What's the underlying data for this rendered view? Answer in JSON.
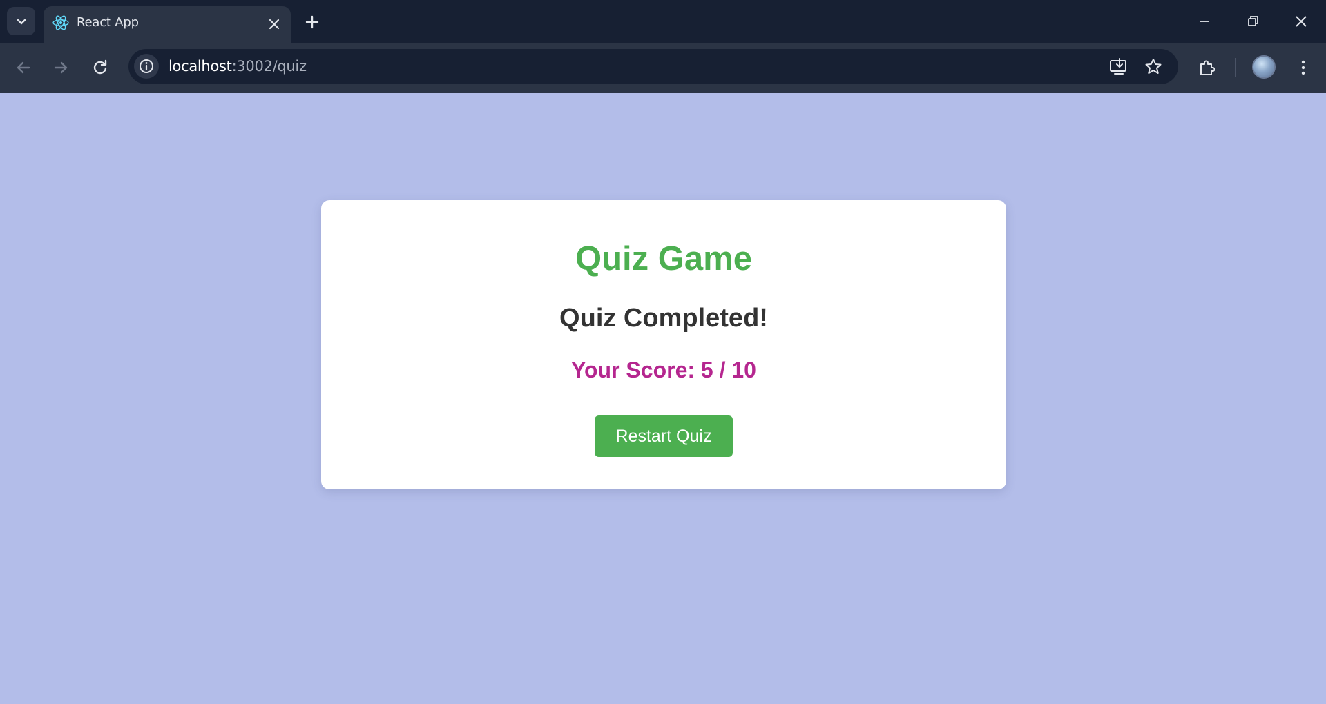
{
  "browser": {
    "tab_title": "React App",
    "url_host": "localhost",
    "url_path": ":3002/quiz"
  },
  "quiz": {
    "title": "Quiz Game",
    "status": "Quiz Completed!",
    "score_text": "Your Score: 5 / 10",
    "score": 5,
    "total": 10,
    "restart_label": "Restart Quiz"
  },
  "colors": {
    "page_background": "#b3bde9",
    "title_green": "#4caf50",
    "score_magenta": "#b5268f",
    "button_green": "#4caf50"
  }
}
